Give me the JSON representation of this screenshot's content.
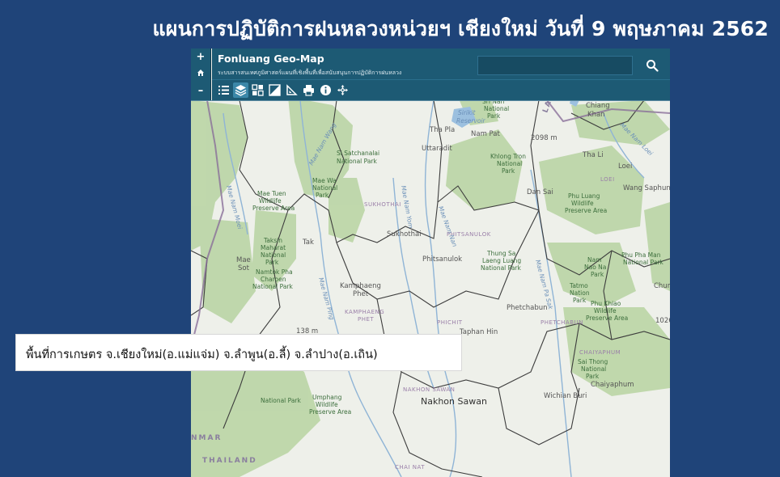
{
  "slide": {
    "title": "แผนการปฏิบัติการฝนหลวงหน่วยฯ เชียงใหม่ วันที่ 9 พฤษภาคม 2562"
  },
  "app": {
    "title": "Fonluang Geo-Map",
    "subtitle": "ระบบสารสนเทศภูมิศาสตร์แผนที่เชิงพื้นที่เพื่อสนับสนุนการปฏิบัติการฝนหลวง",
    "search_placeholder": ""
  },
  "zoom": {
    "in_label": "+",
    "home_label": "⌂",
    "out_label": "–"
  },
  "toolbar": {
    "tools": [
      "legend-icon",
      "layers-icon",
      "basemap-gallery-icon",
      "swipe-icon",
      "measure-icon",
      "print-icon",
      "info-icon",
      "pan-icon"
    ]
  },
  "map": {
    "labels": {
      "sirikit": "Sirikit",
      "reservoir": "Reservoir",
      "nam_pat": "Nam Pat",
      "tha_pla": "Tha Pla",
      "uttaradit": "Uttaradit",
      "chiang_khan": "Chiang",
      "chiang_khan2": "Khan",
      "tha_li": "Tha Li",
      "loei": "Loei",
      "loei_prov": "LOEI",
      "wang_saphung": "Wang Saphun",
      "dan_sai": "Dan Sai",
      "phu_luang": "Phu Luang",
      "phu_luang2": "Wildlife",
      "phu_luang3": "Preserve Area",
      "si_satchanalai": "Si Satchanalai",
      "si_satchanalai2": "National Park",
      "khlong_tron": "Khlong Tron",
      "khlong_tron2": "National",
      "khlong_tron3": "Park",
      "sukhothai_prov": "SUKHOTHAI",
      "sukhothai": "Sukhothai",
      "phitsanulok_prov": "PHITSANULOK",
      "phitsanulok": "Phitsanulok",
      "mae_tuen": "Mae Tuen",
      "mae_tuen2": "Wildlife",
      "mae_tuen3": "Preserve Area",
      "mae_wa": "Mae Wa",
      "mae_wa2": "National",
      "mae_wa3": "Park",
      "tak": "Tak",
      "taksin": "Taksin",
      "taksin2": "Maharat",
      "taksin3": "National",
      "taksin4": "Park",
      "namtok": "Namtok Pha",
      "namtok2": "Charoen",
      "namtok3": "National Park",
      "mae_sot": "Mae",
      "mae_sot2": "Sot",
      "thung_salaeng": "Thung Sa",
      "thung_salaeng2": "Laeng Luang",
      "thung_salaeng3": "National Park",
      "nam_nao": "Nam",
      "nam_nao2": "Nao Na",
      "nam_nao3": "Park",
      "phu_pha_man": "Phu Pha Man",
      "phu_pha_man2": "National Park",
      "kamphaeng_phet": "Kamphaeng",
      "kamphaeng_phet2": "Phet",
      "kamphaeng_prov": "KAMPHAENG",
      "kamphaeng_prov2": "PHET",
      "phichit_prov": "PHICHIT",
      "phetchabun_prov": "PHETCHABUN",
      "phetchabun": "Phetchabun",
      "taphan_hin": "Taphan Hin",
      "tat_mok": "Tatmo",
      "tat_mok2": "Nation",
      "tat_mok3": "Park",
      "phu_khiao": "Phu Khiao",
      "phu_khiao2": "Wildlife",
      "phu_khiao3": "Preserve Area",
      "chaiyaphum_prov": "CHAIYAPHUM",
      "chaiyaphum": "Chaiyaphum",
      "sai_thong": "Sai Thong",
      "sai_thong2": "National",
      "sai_thong3": "Park",
      "nakhon_sawan_prov": "NAKHON SAWAN",
      "nakhon_sawan": "Nakhon Sawan",
      "wichian_buri": "Wichian Buri",
      "umphang": "Umphang",
      "umphang2": "Wildlife",
      "umphang3": "Preserve Area",
      "myanmar": "NMAR",
      "thailand": "THAILAND",
      "chai_nat": "CHAI NAT",
      "laos": "LAOS",
      "elev_1": "2098 m",
      "elev_2": "138 m",
      "elev_3": "1026",
      "chum": "Chum",
      "river_ping": "Mae Nam Ping",
      "river_nan": "Mae Nam Nan",
      "river_yom": "Mae Nam Yom",
      "river_wang": "Mae Nam Wang",
      "river_pa_sak": "Mae Nam Pa Sak",
      "river_moei": "Mae Nam Moei",
      "river_loei": "Mae Nam Loei",
      "khlong_lan": "National Park",
      "sri_nan": "Sri Nan",
      "sri_nan2": "National",
      "sri_nan3": "Park"
    }
  },
  "caption": {
    "text": "พื้นที่การเกษตร จ.เชียงใหม่(อ.แม่แจ่ม) จ.ลำพูน(อ.ลี้) จ.ลำปาง(อ.เถิน)"
  },
  "colors": {
    "background": "#1f4479",
    "header": "#1d5a74",
    "forest": "#b9d3a6",
    "land": "#eef0ea",
    "water": "#9cc0df",
    "border": "#4a4a4a"
  }
}
